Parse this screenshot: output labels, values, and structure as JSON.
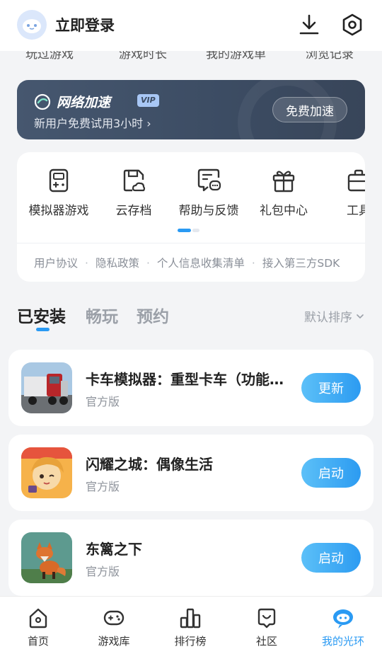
{
  "header": {
    "login_label": "立即登录",
    "download_icon": "download-icon",
    "settings_icon": "settings-icon"
  },
  "stats": [
    "玩过游戏",
    "游戏时长",
    "我的游戏单",
    "浏览记录"
  ],
  "vip": {
    "title": "网络加速",
    "badge": "VIP",
    "subtitle": "新用户免费试用3小时",
    "button_label": "免费加速"
  },
  "tools": [
    {
      "label": "模拟器游戏",
      "icon": "gamepad-icon"
    },
    {
      "label": "云存档",
      "icon": "cloud-save-icon"
    },
    {
      "label": "帮助与反馈",
      "icon": "feedback-icon"
    },
    {
      "label": "礼包中心",
      "icon": "gift-icon"
    },
    {
      "label": "工具",
      "icon": "toolbox-icon"
    }
  ],
  "links": [
    "用户协议",
    "隐私政策",
    "个人信息收集清单",
    "接入第三方SDK"
  ],
  "tabs": {
    "installed": "已安装",
    "playing": "畅玩",
    "reserved": "预约",
    "sort_label": "默认排序"
  },
  "games": [
    {
      "title": "卡车模拟器：重型卡车（功能版）",
      "subtitle": "官方版",
      "button": "更新"
    },
    {
      "title": "闪耀之城：偶像生活",
      "subtitle": "官方版",
      "button": "启动"
    },
    {
      "title": "东篱之下",
      "subtitle": "官方版",
      "button": "启动"
    }
  ],
  "nav": {
    "home": "首页",
    "library": "游戏库",
    "ranking": "排行榜",
    "community": "社区",
    "mine": "我的光环"
  },
  "colors": {
    "accent": "#2a9af3",
    "banner": "#3c4c63"
  }
}
